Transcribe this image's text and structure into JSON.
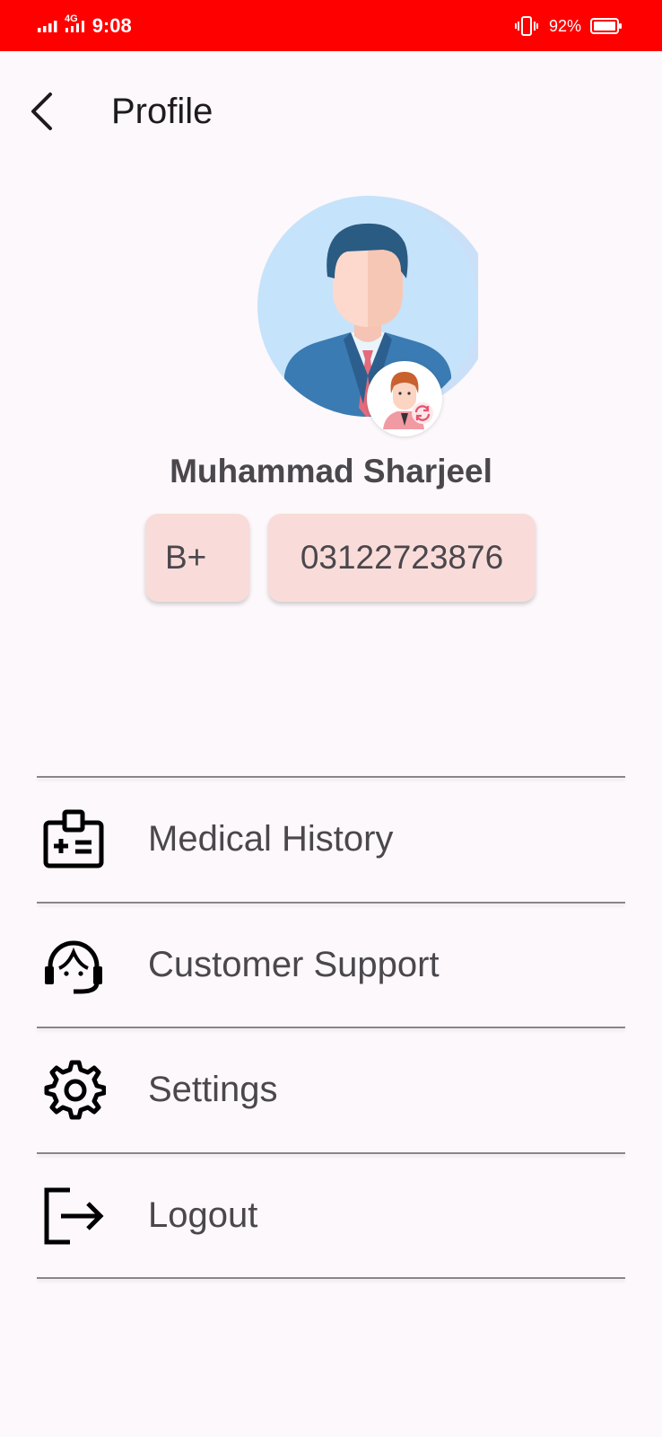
{
  "status_bar": {
    "network": "4G",
    "time": "9:08",
    "battery": "92%",
    "background_color": "#ff0000"
  },
  "header": {
    "title": "Profile"
  },
  "profile": {
    "name": "Muhammad Sharjeel",
    "blood_group": "B+",
    "phone": "03122723876",
    "chip_color": "#f9dcd9"
  },
  "menu": {
    "items": [
      {
        "label": "Medical History",
        "icon": "medical-id-icon"
      },
      {
        "label": "Customer Support",
        "icon": "headset-icon"
      },
      {
        "label": "Settings",
        "icon": "gear-icon"
      },
      {
        "label": "Logout",
        "icon": "logout-icon"
      }
    ]
  }
}
